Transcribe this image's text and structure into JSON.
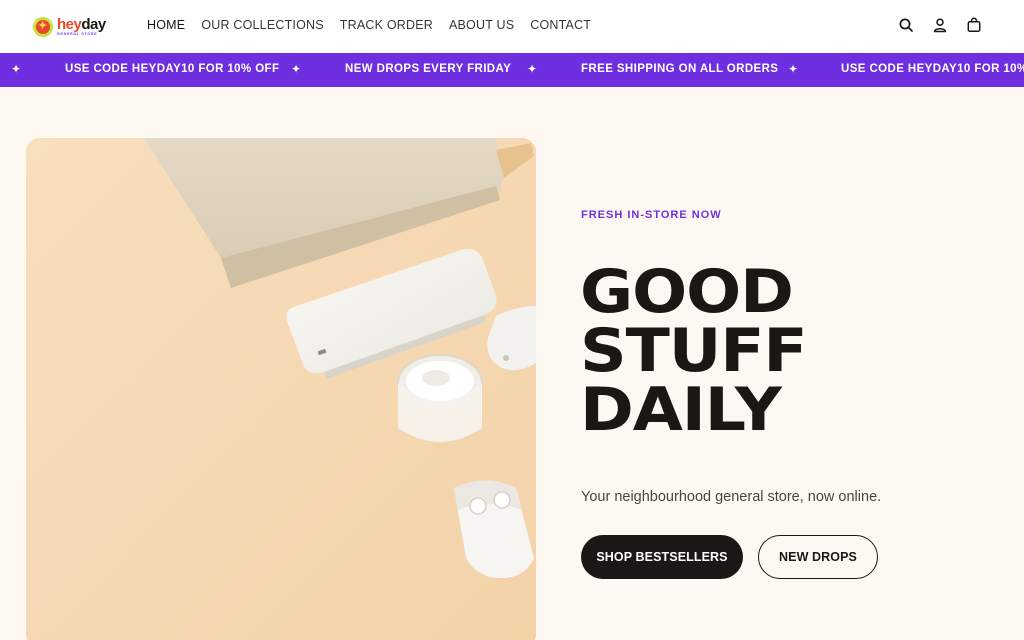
{
  "brand": {
    "name_prefix": "hey",
    "name_suffix": "day",
    "tagline": "GENERAL STORE",
    "logo_icon": "sun-logo-icon",
    "accent": "#6f2fe0",
    "dark": "#1c1715"
  },
  "nav": {
    "items": [
      {
        "label": "HOME"
      },
      {
        "label": "OUR COLLECTIONS"
      },
      {
        "label": "TRACK ORDER"
      },
      {
        "label": "ABOUT US"
      },
      {
        "label": "CONTACT"
      }
    ]
  },
  "header_icons": [
    "search-icon",
    "account-icon",
    "cart-icon"
  ],
  "announcement": {
    "items": [
      "USE CODE HEYDAY10 FOR 10% OFF",
      "NEW DROPS EVERY FRIDAY",
      "FREE SHIPPING ON ALL ORDERS",
      "USE CODE HEYDAY10 FOR 10% OFF"
    ],
    "separator": "+"
  },
  "hero": {
    "eyebrow": "FRESH IN-STORE NOW",
    "headline": [
      "GOOD",
      "STUFF",
      "DAILY"
    ],
    "subtext": "Your neighbourhood general store, now online.",
    "primary_button": "SHOP BESTSELLERS",
    "secondary_button": "NEW DROPS"
  }
}
